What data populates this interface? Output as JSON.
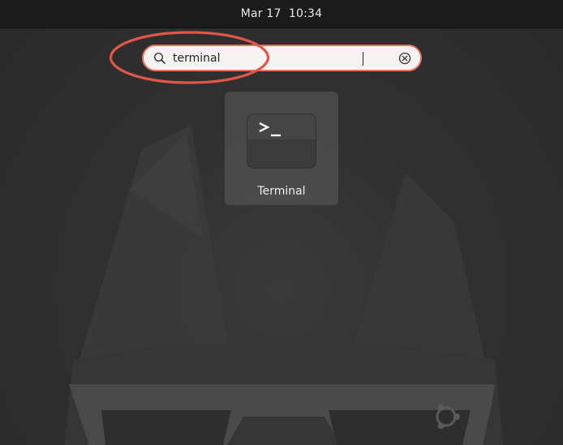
{
  "topbar": {
    "clock": "Mar 17  10:34"
  },
  "search": {
    "value": "terminal",
    "icon": "search-icon",
    "clear_icon": "clear-icon"
  },
  "results": [
    {
      "label": "Terminal",
      "icon": "terminal-icon"
    }
  ],
  "colors": {
    "topbar": "#1b1b1b",
    "background": "#2f2f2f",
    "search_focus_border": "#e8745f",
    "annotation": "#e0574a"
  }
}
